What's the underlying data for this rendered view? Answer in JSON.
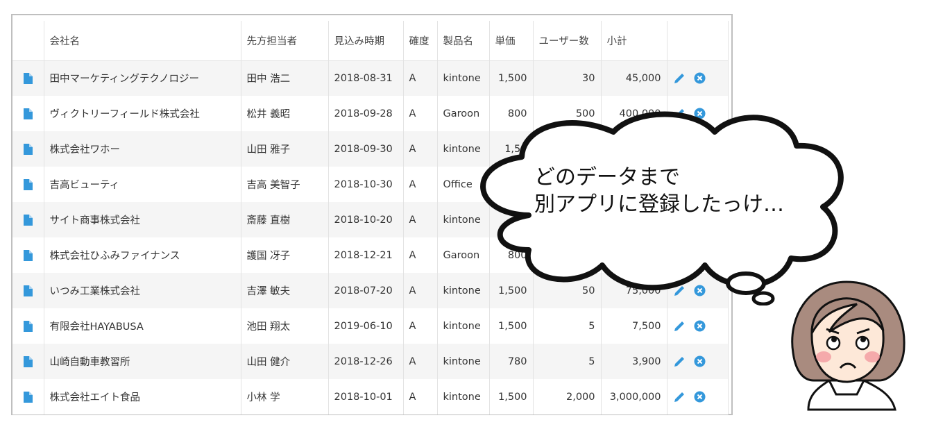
{
  "table": {
    "headers": [
      "",
      "会社名",
      "先方担当者",
      "見込み時期",
      "確度",
      "製品名",
      "単価",
      "ユーザー数",
      "小計",
      ""
    ],
    "rows": [
      {
        "company": "田中マーケティングテクノロジー",
        "contact": "田中 浩二",
        "date": "2018-08-31",
        "confidence": "A",
        "product": "kintone",
        "unit_price": "1,500",
        "users": "30",
        "subtotal": "45,000"
      },
      {
        "company": "ヴィクトリーフィールド株式会社",
        "contact": "松井 義昭",
        "date": "2018-09-28",
        "confidence": "A",
        "product": "Garoon",
        "unit_price": "800",
        "users": "500",
        "subtotal": "400,000"
      },
      {
        "company": "株式会社ワホー",
        "contact": "山田 雅子",
        "date": "2018-09-30",
        "confidence": "A",
        "product": "kintone",
        "unit_price": "1,50",
        "users": "",
        "subtotal": ""
      },
      {
        "company": "吉高ビューティ",
        "contact": "吉高 美智子",
        "date": "2018-10-30",
        "confidence": "A",
        "product": "Office",
        "unit_price": "",
        "users": "",
        "subtotal": ""
      },
      {
        "company": "サイト商事株式会社",
        "contact": "斎藤 直樹",
        "date": "2018-10-20",
        "confidence": "A",
        "product": "kintone",
        "unit_price": "",
        "users": "",
        "subtotal": ""
      },
      {
        "company": "株式会社ひふみファイナンス",
        "contact": "護国 冴子",
        "date": "2018-12-21",
        "confidence": "A",
        "product": "Garoon",
        "unit_price": "800",
        "users": "",
        "subtotal": ""
      },
      {
        "company": "いつみ工業株式会社",
        "contact": "吉澤 敏夫",
        "date": "2018-07-20",
        "confidence": "A",
        "product": "kintone",
        "unit_price": "1,500",
        "users": "50",
        "subtotal": "75,000"
      },
      {
        "company": "有限会社HAYABUSA",
        "contact": "池田 翔太",
        "date": "2019-06-10",
        "confidence": "A",
        "product": "kintone",
        "unit_price": "1,500",
        "users": "5",
        "subtotal": "7,500"
      },
      {
        "company": "山崎自動車教習所",
        "contact": "山田 健介",
        "date": "2018-12-26",
        "confidence": "A",
        "product": "kintone",
        "unit_price": "780",
        "users": "5",
        "subtotal": "3,900"
      },
      {
        "company": "株式会社エイト食品",
        "contact": "小林 学",
        "date": "2018-10-01",
        "confidence": "A",
        "product": "kintone",
        "unit_price": "1,500",
        "users": "2,000",
        "subtotal": "3,000,000"
      }
    ]
  },
  "bubble": {
    "line1": "どのデータまで",
    "line2": "別アプリに登録したっけ…"
  },
  "icons": {
    "record": "document-icon",
    "edit": "pencil-icon",
    "delete": "close-circle-icon"
  },
  "colors": {
    "accent": "#3498db",
    "row_alt": "#f5f5f5",
    "border": "#bfbfbf"
  }
}
